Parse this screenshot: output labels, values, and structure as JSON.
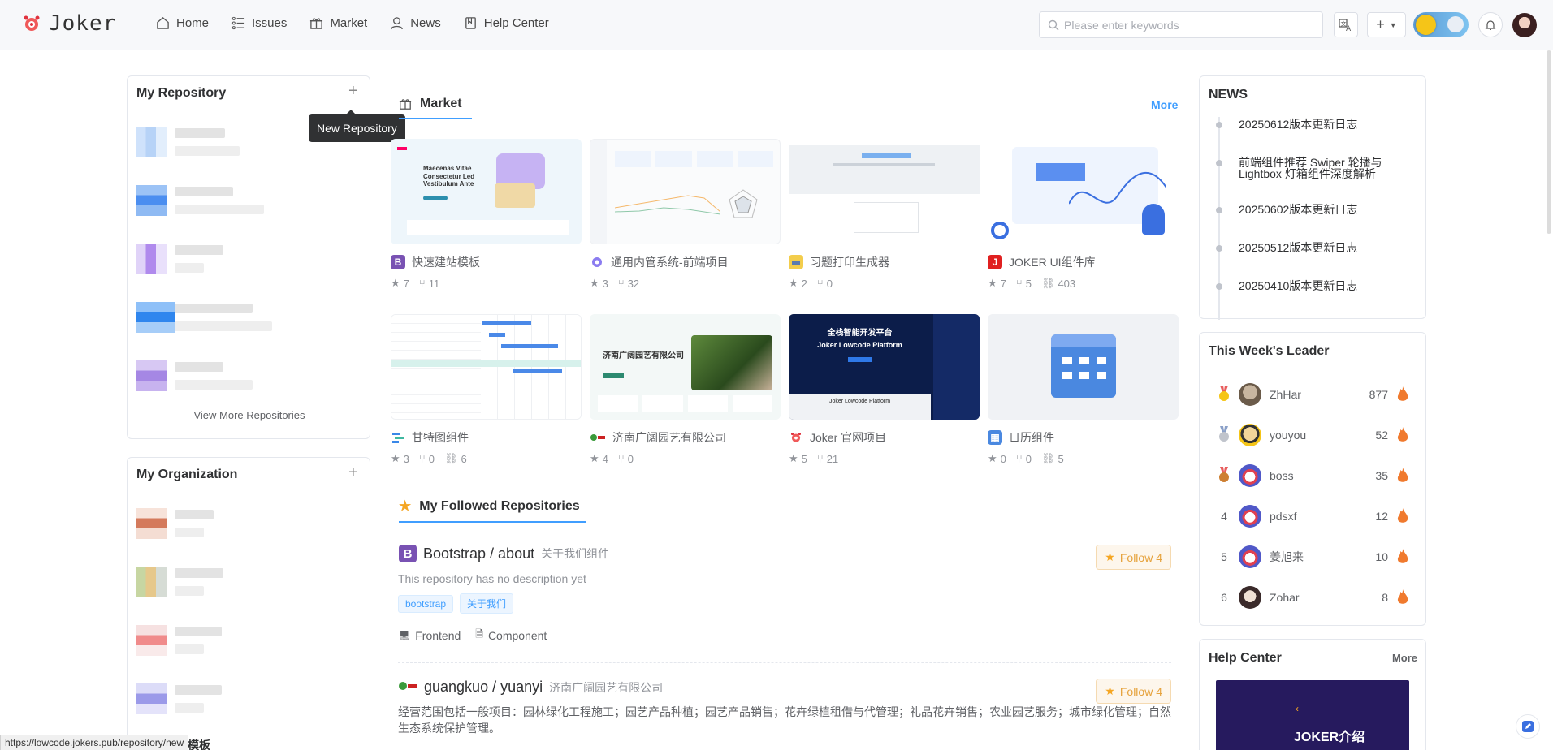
{
  "header": {
    "logo_text": "Joker",
    "nav": [
      {
        "label": "Home",
        "icon": "home-icon"
      },
      {
        "label": "Issues",
        "icon": "list-icon"
      },
      {
        "label": "Market",
        "icon": "gift-icon"
      },
      {
        "label": "News",
        "icon": "user-icon"
      },
      {
        "label": "Help Center",
        "icon": "book-icon"
      }
    ],
    "search_placeholder": "Please enter keywords",
    "search_value": ""
  },
  "left": {
    "repo_title": "My Repository",
    "view_more": "View More Repositories",
    "org_title": "My Organization",
    "partial_text": "纹模板",
    "tooltip": "New Repository"
  },
  "market": {
    "title": "Market",
    "more": "More",
    "items": [
      {
        "name": "快速建站模板",
        "star": "7",
        "fork": "11",
        "link": ""
      },
      {
        "name": "通用内管系统-前端项目",
        "star": "3",
        "fork": "32",
        "link": ""
      },
      {
        "name": "习题打印生成器",
        "star": "2",
        "fork": "0",
        "link": ""
      },
      {
        "name": "JOKER UI组件库",
        "star": "7",
        "fork": "5",
        "link": "403"
      },
      {
        "name": "甘特图组件",
        "star": "3",
        "fork": "0",
        "link": "6"
      },
      {
        "name": "济南广阔园艺有限公司",
        "star": "4",
        "fork": "0",
        "link": ""
      },
      {
        "name": "Joker 官网项目",
        "star": "5",
        "fork": "21",
        "link": ""
      },
      {
        "name": "日历组件",
        "star": "0",
        "fork": "0",
        "link": "5"
      }
    ],
    "thumb_texts": {
      "t1": "Maecenas Vitae Consectetur Led Vestibulum Ante",
      "t6": "济南广阔园艺有限公司",
      "t7a": "全栈智能开发平台",
      "t7b": "Joker Lowcode Platform",
      "t7c": "Joker Lowcode Platform"
    }
  },
  "followed": {
    "title": "My Followed Repositories",
    "repos": [
      {
        "owner_repo": "Bootstrap / about",
        "sub": "关于我们组件",
        "desc": "This repository has no description yet",
        "tags": [
          "bootstrap",
          "关于我们"
        ],
        "meta": [
          "Frontend",
          "Component"
        ],
        "follow": "Follow 4"
      },
      {
        "owner_repo": "guangkuo / yuanyi",
        "sub": "济南广阔园艺有限公司",
        "desc": "经营范围包括一般项目：园林绿化工程施工；园艺产品种植；园艺产品销售；花卉绿植租借与代管理；礼品花卉销售；农业园艺服务；城市绿化管理；自然生态系统保护管理。",
        "follow": "Follow 4"
      }
    ]
  },
  "news": {
    "title": "NEWS",
    "items": [
      "20250612版本更新日志",
      "前端组件推荐 Swiper 轮播与 Lightbox 灯箱组件深度解析",
      "20250602版本更新日志",
      "20250512版本更新日志",
      "20250410版本更新日志"
    ]
  },
  "leader": {
    "title": "This Week's Leader",
    "rows": [
      {
        "rank": "",
        "name": "ZhHar",
        "score": "877",
        "medal": "gold"
      },
      {
        "rank": "",
        "name": "youyou",
        "score": "52",
        "medal": "silver"
      },
      {
        "rank": "",
        "name": "boss",
        "score": "35",
        "medal": "bronze"
      },
      {
        "rank": "4",
        "name": "pdsxf",
        "score": "12",
        "medal": ""
      },
      {
        "rank": "5",
        "name": "姜旭来",
        "score": "10",
        "medal": ""
      },
      {
        "rank": "6",
        "name": "Zohar",
        "score": "8",
        "medal": ""
      }
    ]
  },
  "help": {
    "title": "Help Center",
    "more": "More",
    "banner": "JOKER介绍"
  },
  "status_url": "https://lowcode.jokers.pub/repository/new",
  "colors": {
    "accent": "#409eff",
    "follow": "#e6a23c"
  }
}
